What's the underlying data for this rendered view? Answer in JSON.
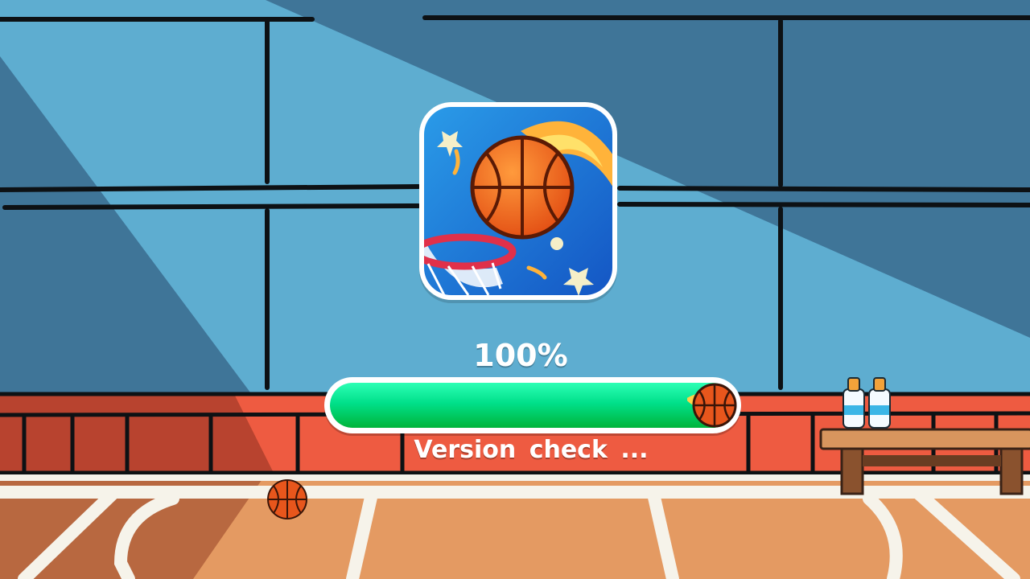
{
  "loading": {
    "percent_label": "100%",
    "progress": 1.0,
    "status_label": "Version  check ..."
  },
  "colors": {
    "wall_light": "#5eadd0",
    "wall_dark": "#3f7598",
    "brick": "#ee5b41",
    "floor": "#e49a62",
    "progress_green": "#00d06a"
  }
}
